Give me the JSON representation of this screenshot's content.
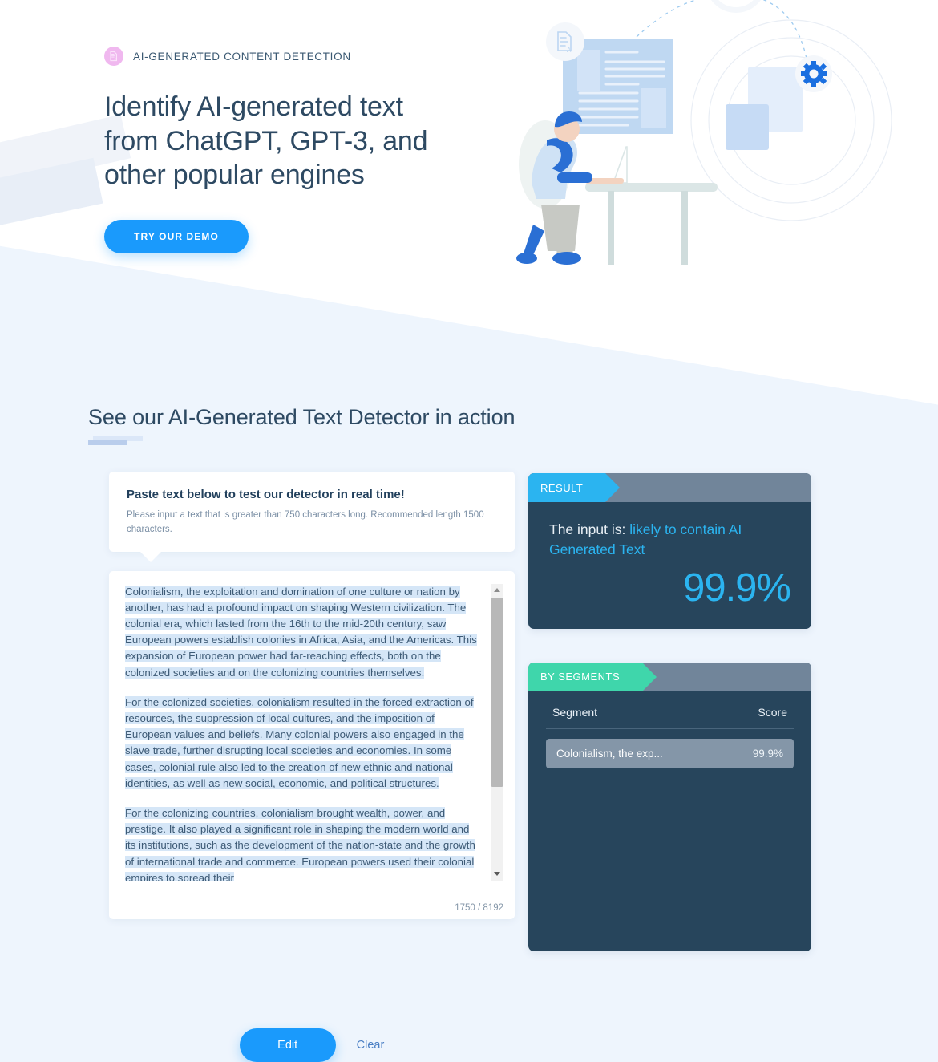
{
  "hero": {
    "eyebrow": "AI-GENERATED CONTENT DETECTION",
    "badge_icon": "document-ai-icon",
    "title": "Identify AI-generated text from ChatGPT, GPT-3, and other popular engines",
    "cta_label": "TRY OUR DEMO",
    "accent_color": "#1a9afc",
    "badge_color": "#f0b8ef",
    "title_color": "#2e4a63"
  },
  "demo": {
    "section_title": "See our AI-Generated Text Detector in action",
    "prompt": {
      "title": "Paste text below to test our detector in real time!",
      "subtitle": "Please input a text that is greater than 750 characters long. Recommended length 1500 characters."
    },
    "editor": {
      "paragraphs": [
        "Colonialism, the exploitation and domination of one culture or nation by another, has had a profound impact on shaping Western civilization. The colonial era, which lasted from the 16th to the mid-20th century, saw European powers establish colonies in Africa, Asia, and the Americas. This expansion of European power had far-reaching effects, both on the colonized societies and on the colonizing countries themselves.",
        "For the colonized societies, colonialism resulted in the forced extraction of resources, the suppression of local cultures, and the imposition of European values and beliefs. Many colonial powers also engaged in the slave trade, further disrupting local societies and economies. In some cases, colonial rule also led to the creation of new ethnic and national identities, as well as new social, economic, and political structures.",
        "For the colonizing countries, colonialism brought wealth, power, and prestige. It also played a significant role in shaping the modern world and its institutions, such as the development of the nation-state and the growth of international trade and commerce. European powers used their colonial empires to spread their"
      ],
      "char_count": "1750 / 8192",
      "selection_highlight": "#d5e6f7"
    },
    "actions": {
      "edit_label": "Edit",
      "clear_label": "Clear"
    },
    "result_panel": {
      "tab_label": "RESULT",
      "tab_color": "#2bb4f0",
      "prefix": "The input is: ",
      "verdict": "likely to contain AI Generated Text",
      "percent": "99.9%",
      "panel_bg": "#27455c"
    },
    "segments_panel": {
      "tab_label": "BY SEGMENTS",
      "tab_color": "#3fd6ab",
      "columns": [
        "Segment",
        "Score"
      ],
      "rows": [
        {
          "segment": "Colonialism, the exp...",
          "score": "99.9%"
        }
      ]
    }
  }
}
